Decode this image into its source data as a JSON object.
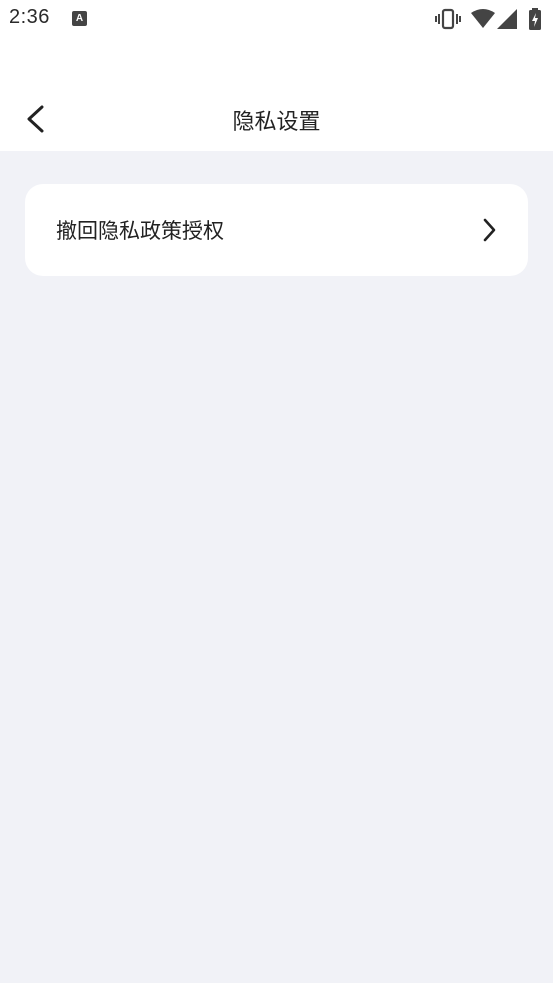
{
  "status_bar": {
    "time": "2:36",
    "app_icon_letter": "A",
    "icons": [
      "vibrate-icon",
      "wifi-icon",
      "signal-icon",
      "battery-charging-icon"
    ]
  },
  "header": {
    "title": "隐私设置",
    "back_icon": "chevron-left-icon"
  },
  "settings": {
    "items": [
      {
        "label": "撤回隐私政策授权",
        "icon": "chevron-right-icon"
      }
    ]
  },
  "colors": {
    "background": "#f1f2f7",
    "surface": "#ffffff",
    "text": "#222222"
  }
}
